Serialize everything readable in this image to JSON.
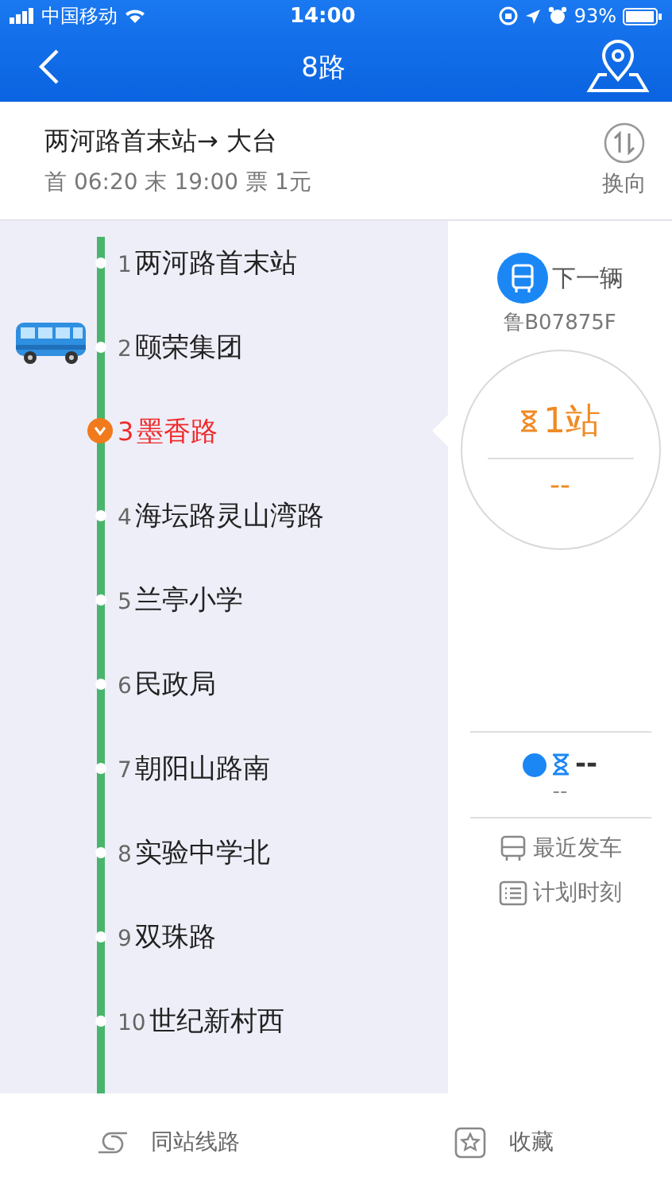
{
  "status_bar": {
    "carrier": "中国移动",
    "time": "14:00",
    "battery": "93%"
  },
  "nav": {
    "title": "8路"
  },
  "route": {
    "direction": "两河路首末站→ 大台",
    "schedule": "首 06:20 末 19:00 票 1元",
    "swap_label": "换向"
  },
  "stations": [
    {
      "number": "1",
      "name": "两河路首末站",
      "selected": false,
      "bus_here": false
    },
    {
      "number": "2",
      "name": "颐荣集团",
      "selected": false,
      "bus_here": true
    },
    {
      "number": "3",
      "name": "墨香路",
      "selected": true,
      "bus_here": false
    },
    {
      "number": "4",
      "name": "海坛路灵山湾路",
      "selected": false,
      "bus_here": false
    },
    {
      "number": "5",
      "name": "兰亭小学",
      "selected": false,
      "bus_here": false
    },
    {
      "number": "6",
      "name": "民政局",
      "selected": false,
      "bus_here": false
    },
    {
      "number": "7",
      "name": "朝阳山路南",
      "selected": false,
      "bus_here": false
    },
    {
      "number": "8",
      "name": "实验中学北",
      "selected": false,
      "bus_here": false
    },
    {
      "number": "9",
      "name": "双珠路",
      "selected": false,
      "bus_here": false
    },
    {
      "number": "10",
      "name": "世纪新村西",
      "selected": false,
      "bus_here": false
    }
  ],
  "next_bus": {
    "label": "下一辆",
    "plate": "鲁B07875F",
    "stops": "1站",
    "eta": "--"
  },
  "following_bus": {
    "stops": "--",
    "eta": "--"
  },
  "actions": [
    {
      "kind": "recent",
      "label": "最近发车"
    },
    {
      "kind": "schedule",
      "label": "计划时刻"
    }
  ],
  "bottom_bar": [
    {
      "kind": "same-stop",
      "label": "同站线路"
    },
    {
      "kind": "favorite",
      "label": "收藏"
    }
  ]
}
